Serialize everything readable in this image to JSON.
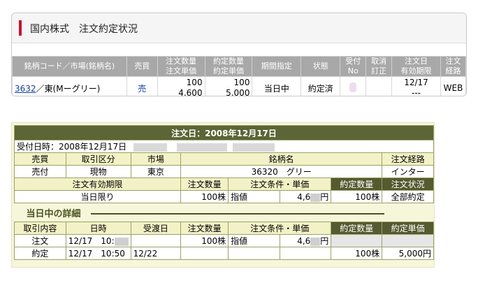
{
  "order_status": {
    "title": "国内株式　注文約定状況",
    "headers": {
      "brand_market": "銘柄コード／市場(銘柄名)",
      "buy_sell": "売買",
      "qty_price": [
        "注文数量",
        "注文単価"
      ],
      "exec_qty_price": [
        "約定数量",
        "約定単価"
      ],
      "period": "期間指定",
      "status": "状態",
      "receipt_no": [
        "受付",
        "No"
      ],
      "cancel_fix": [
        "取消",
        "訂正"
      ],
      "order_date_validity": [
        "注文日",
        "有効期限"
      ],
      "route": [
        "注文",
        "経路"
      ]
    },
    "row": {
      "code": "3632",
      "market_name": "／東(Mーグリー)",
      "side": "売",
      "order_qty": "100",
      "order_price": "4,600",
      "exec_qty": "100",
      "exec_price": "5,000",
      "period": "当日中",
      "status": "約定済",
      "order_date": "12/17",
      "validity": "---",
      "route": "WEB"
    }
  },
  "detail": {
    "banner": "注文日：2008年12月17日",
    "received_label": "受付日時：2008年12月17日",
    "headers1": [
      "売買",
      "取引区分",
      "市場",
      "銘柄名",
      "注文経路"
    ],
    "values1": [
      "売付",
      "現物",
      "東京",
      "36320　グリー",
      "インター"
    ],
    "headers2": [
      "注文有効期限",
      "注文数量",
      "注文条件・単価",
      "約定数量",
      "注文状況"
    ],
    "values2": {
      "validity": "当日限り",
      "qty": "100株",
      "cond": "指値",
      "price_prefix": "4,6",
      "price_unit": "円",
      "exec_qty": "100株",
      "state": "全部約定"
    },
    "section_title": "当日中の詳細",
    "headers3": [
      "取引内容",
      "日時",
      "受渡日",
      "注文数量",
      "注文条件・単価",
      "約定数量",
      "約定単価"
    ],
    "rows": [
      {
        "kind": "注文",
        "datetime": "12/17　10:",
        "delivery": "",
        "qty": "100株",
        "cond": "指値",
        "price_prefix": "4,6",
        "price_unit": "円",
        "exec_qty": "",
        "exec_price": ""
      },
      {
        "kind": "約定",
        "datetime": "12/17　10:50",
        "delivery": "12/22",
        "qty": "",
        "cond": "",
        "price_prefix": "",
        "price_unit": "",
        "exec_qty": "100株",
        "exec_price": "5,000円"
      }
    ]
  },
  "colors": {
    "accent_bar": "#c8102e",
    "header_gray": "#a8a8a8",
    "banner_olive": "#5b6535",
    "link_blue": "#1540a0"
  }
}
